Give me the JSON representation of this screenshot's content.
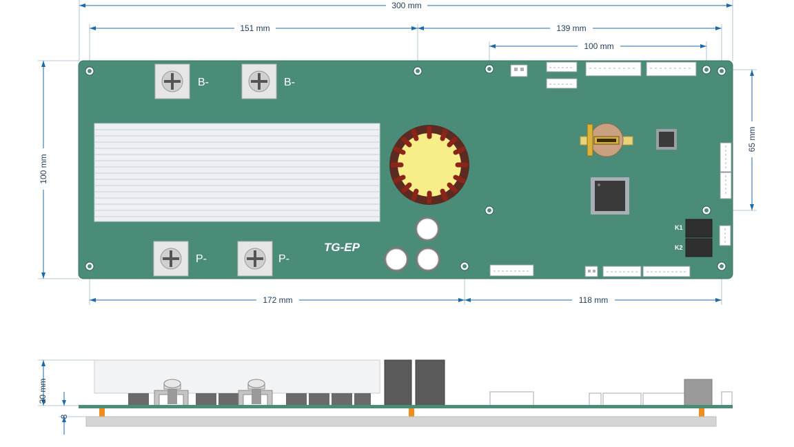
{
  "colors": {
    "pcb": "#4a8c78",
    "pcb_edge": "#3a7564",
    "dimension": "#1c6aa8",
    "heatsink": "#eef1f4",
    "toroid_core": "#f7ee8a",
    "toroid_winding": "#7a1f14",
    "connector": "#ffffff",
    "chip": "#3a3a3a",
    "capacitor": "#d0d0d0",
    "battery_gold": "#d8b23a",
    "standoff": "#f08c1e",
    "baseplate": "#d5d5d5",
    "mosfet_side": "#5a5a5a"
  },
  "dimensions": {
    "overall_width": "300 mm",
    "top_left_span": "151 mm",
    "top_right_span": "139 mm",
    "connector_span": "100 mm",
    "board_height": "100 mm",
    "right_hole_spacing": "65 mm",
    "bottom_left_span": "172 mm",
    "bottom_right_span": "118 mm",
    "side_height": "30 mm",
    "side_standoff": "8"
  },
  "terminals": {
    "b_minus_1": "B-",
    "b_minus_2": "B-",
    "p_minus_1": "P-",
    "p_minus_2": "P-"
  },
  "relays": {
    "k1": "K1",
    "k2": "K2"
  },
  "logo": {
    "text": "TG-EP"
  },
  "icons": {
    "terminal": "cross-screw-icon",
    "mounting_hole": "mounting-hole-icon"
  }
}
